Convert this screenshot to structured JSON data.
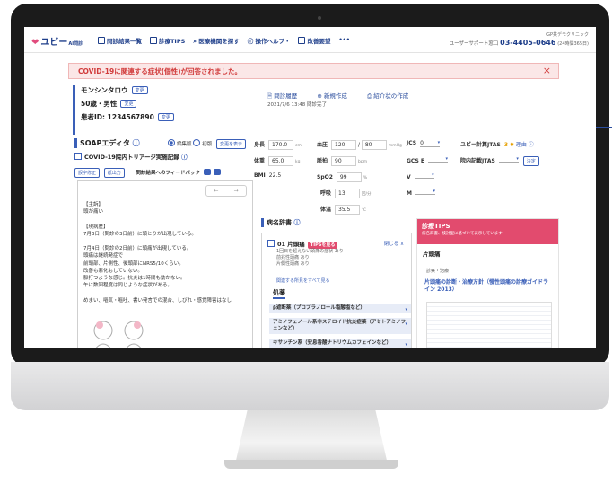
{
  "app": {
    "logo": "ユビー",
    "logo_sub": "AI問診",
    "nav": [
      "問診結果一覧",
      "診療TIPS",
      "医療機関を探す",
      "操作ヘルプ・",
      "改善要望",
      "•••"
    ],
    "clinic": "GP共デモクリニック",
    "support_label": "ユーザーサポート窓口",
    "phone": "03-4405-0646",
    "hours": "(24時間365日)"
  },
  "banner": {
    "text": "COVID-19に関連する症状(個性)が回答されました。",
    "close": "×"
  },
  "patient": {
    "name": "モンシンタロウ",
    "age_sex": "50歳・男性",
    "id": "患者ID: 1234567890",
    "tag": "変更"
  },
  "page_actions": [
    "問診履歴",
    "新規作成",
    "紹介状の作成"
  ],
  "page_date": "2021/7/6 13:48 問診完了",
  "soap": {
    "title": "SOAPエディタ",
    "radio_1": "編集版",
    "radio_2": "初版",
    "show_changes": "変更を表示",
    "covid": "COVID-19院内トリアージ実施記録",
    "tool_1": "誤字修正",
    "tool_2": "紙出力",
    "feedback": "問診結果へのフィードバック",
    "text": "【主訴】\n頭が痛い\n\n【現病歴】\n7月3日（問診の3日前）に頭とりが出現している。\n\n7月4日（問診の2日前）に頭痛が出現している。\n頭痛は継続発症で\n前頭部、片側性、後頭部にNRS5/10くらい。\n改善も悪化もしていない。\n脈打つような感じ。抗炎は1時間も動かない。\n午に数回程度は同じような症状がある。\n\nめまい、嘔気・嘔吐、書い発言での混合、しびれ・感覚障害はなし"
  },
  "vitals": {
    "height_label": "身長",
    "height": "170.0",
    "height_unit": "cm",
    "bp_label": "血圧",
    "bp_sys": "120",
    "bp_dia": "80",
    "bp_unit": "mmHg",
    "jcs_label": "JCS",
    "jcs": "0",
    "jtas_label": "ユビー計算JTAS",
    "jtas_level": "3",
    "jtas_reason": "理由",
    "weight_label": "体重",
    "weight": "65.0",
    "weight_unit": "kg",
    "pulse_label": "脈拍",
    "pulse": "90",
    "pulse_unit": "bpm",
    "gcs_label": "GCS E",
    "gcs": "",
    "in_jtas_label": "院内記載JTAS",
    "in_jtas_btn": "決定",
    "bmi_label": "BMI",
    "bmi": "22.5",
    "spo2_label": "SpO2",
    "spo2": "99",
    "spo2_unit": "%",
    "v_label": "V",
    "resp_label": "呼吸",
    "resp": "13",
    "resp_unit": "回/分",
    "m_label": "M",
    "temp_label": "体温",
    "temp": "35.5",
    "temp_unit": "℃"
  },
  "dict": {
    "title": "病名辞書",
    "candidate": "01 片頭痛",
    "tips_btn": "TIPSを見る",
    "close": "閉じる",
    "notes": "1回目を超えない頭痛の症状 あり\n前兆性頭痛 あり\n片側性頭痛 あり",
    "show_all": "関連する所見をすべて見る",
    "drugs_title": "処薬",
    "drugs": [
      "β遮断薬（プロプラノロール塩酸塩など）",
      "アミノフェノール系非ステロイド抗炎症薬（アセトアミノフェンなど）",
      "キサンチン系（安息香酸ナトリウムカフェインなど）"
    ]
  },
  "tips": {
    "title": "診療TIPS",
    "subtitle": "病名辞書、検討型に基づいて表示しています",
    "dx": "片頭痛",
    "category": "診察・治療",
    "doc": "片頭痛の診断・治療方針（慢性頭痛の診療ガイドライン 2013）"
  }
}
